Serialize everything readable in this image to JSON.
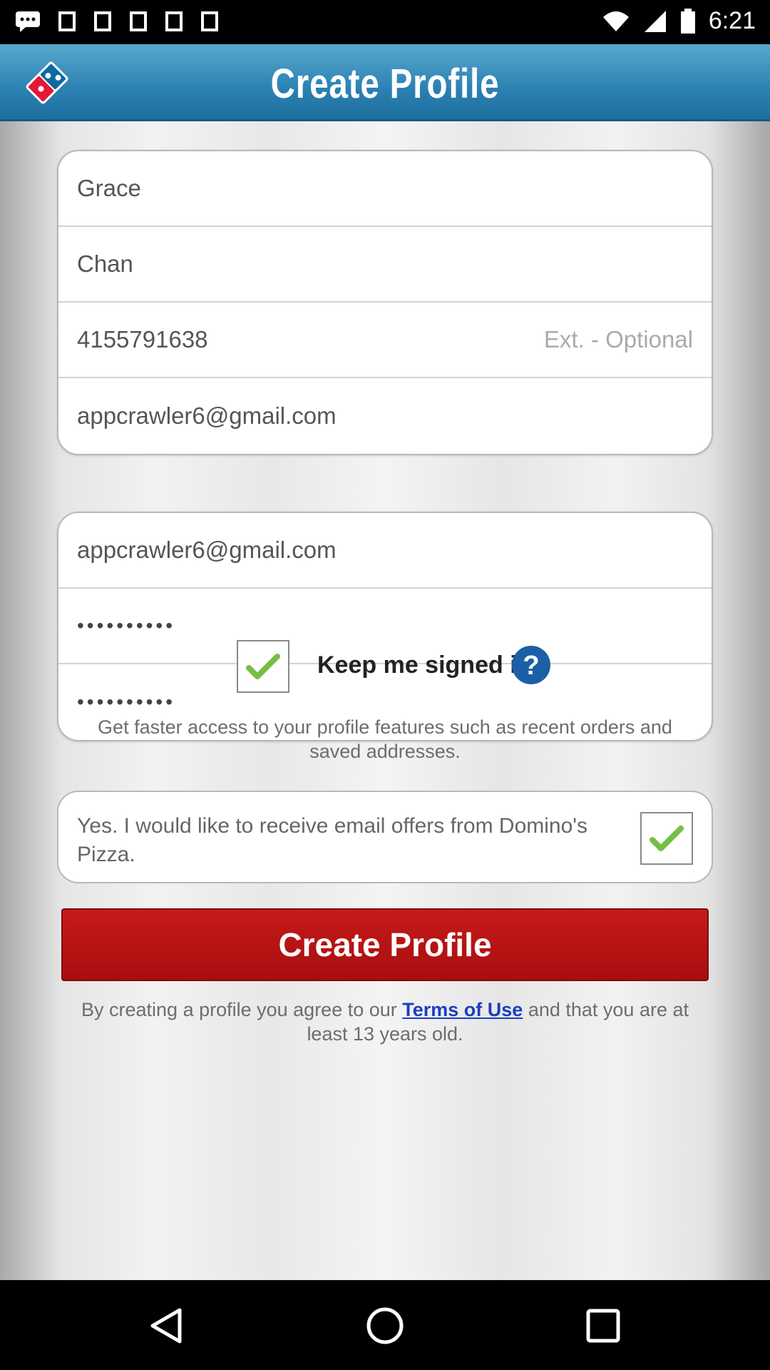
{
  "status_bar": {
    "time": "6:21",
    "icons": [
      "chat-icon",
      "image-icon",
      "image-icon",
      "image-icon",
      "image-icon",
      "image-icon",
      "wifi-icon",
      "signal-icon",
      "battery-icon"
    ]
  },
  "header": {
    "title": "Create Profile",
    "logo": "dominos-logo"
  },
  "personal_info": {
    "first_name": "Grace",
    "last_name": "Chan",
    "phone": "4155791638",
    "ext_placeholder": "Ext. - Optional",
    "email": "appcrawler6@gmail.com"
  },
  "account_info": {
    "confirm_email": "appcrawler6@gmail.com",
    "password": "••••••••••",
    "confirm_password": "••••••••••"
  },
  "keep_signed_in": {
    "label": "Keep me signed in",
    "checked": true
  },
  "info_text": "Get faster access to your profile features such as recent orders and saved addresses.",
  "email_offers": {
    "label": "Yes. I would like to receive email offers from Domino's Pizza.",
    "checked": true
  },
  "create_button_label": "Create Profile",
  "terms": {
    "prefix": "By creating a profile you agree to our ",
    "link": "Terms of Use",
    "suffix": " and that you are at least 13 years old."
  },
  "colors": {
    "header": "#2b81b2",
    "button": "#b71414",
    "link": "#1b3fbf",
    "check": "#74c043"
  }
}
